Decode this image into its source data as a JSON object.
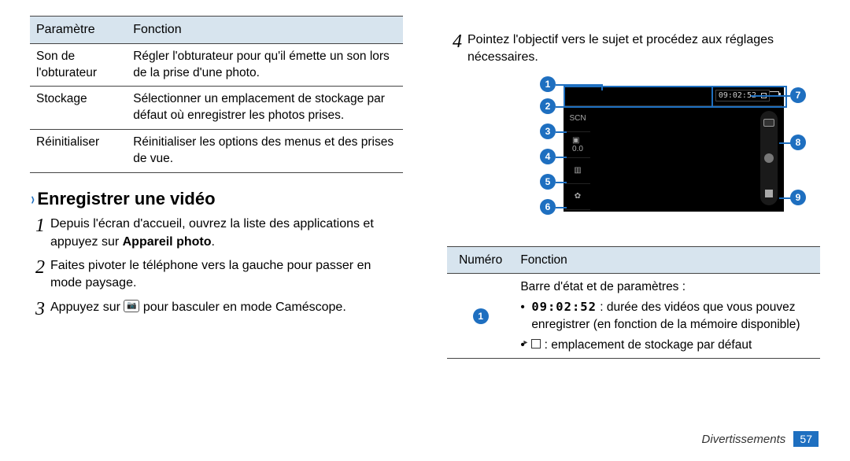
{
  "left_table": {
    "head": [
      "Paramètre",
      "Fonction"
    ],
    "rows": [
      {
        "p": "Son de l'obturateur",
        "f": "Régler l'obturateur pour qu'il émette un son lors de la prise d'une photo."
      },
      {
        "p": "Stockage",
        "f": "Sélectionner un emplacement de stockage par défaut où enregistrer les photos prises."
      },
      {
        "p": "Réinitialiser",
        "f": "Réinitialiser les options des menus et des prises de vue."
      }
    ]
  },
  "section_title": "Enregistrer une vidéo",
  "steps_left": [
    {
      "n": "1",
      "txt_pre": "Depuis l'écran d'accueil, ouvrez la liste des applications et appuyez sur ",
      "bold": "Appareil photo",
      "txt_post": "."
    },
    {
      "n": "2",
      "txt_pre": "Faites pivoter le téléphone vers la gauche pour passer en mode paysage.",
      "bold": "",
      "txt_post": ""
    },
    {
      "n": "3",
      "txt_pre": "Appuyez sur ",
      "icon": "camera",
      "txt_post": " pour basculer en mode Caméscope."
    }
  ],
  "step_right": {
    "n": "4",
    "txt": "Pointez l'objectif vers le sujet et procédez aux réglages nécessaires."
  },
  "diagram": {
    "time_readout": "09:02:52",
    "callouts_left": [
      "1",
      "2",
      "3",
      "4",
      "5",
      "6"
    ],
    "callouts_right": [
      "7",
      "8",
      "9"
    ]
  },
  "right_table": {
    "head": [
      "Numéro",
      "Fonction"
    ],
    "row_label": "1",
    "row_title": "Barre d'état et de paramètres :",
    "bullet1_time": "09:02:52",
    "bullet1_rest": " : durée des vidéos que vous pouvez enregistrer (en fonction de la mémoire disponible)",
    "bullet2_rest": " : emplacement de stockage par défaut"
  },
  "footer": {
    "label": "Divertissements",
    "page": "57"
  }
}
